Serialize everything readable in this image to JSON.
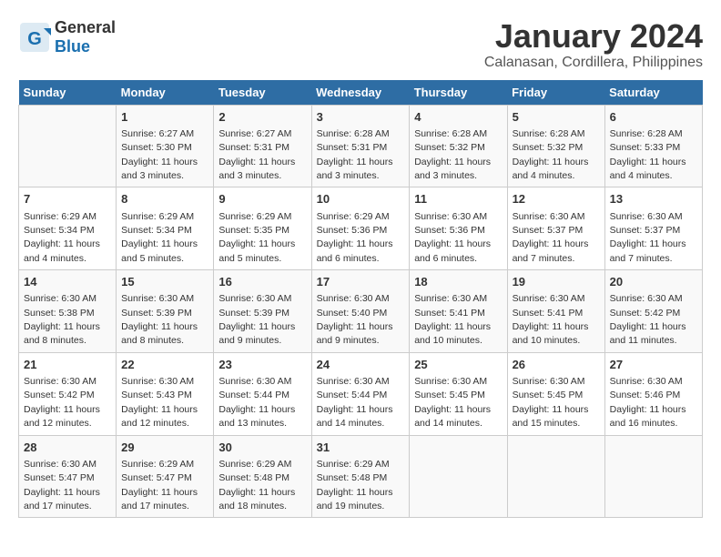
{
  "header": {
    "logo_general": "General",
    "logo_blue": "Blue",
    "month": "January 2024",
    "location": "Calanasan, Cordillera, Philippines"
  },
  "days_of_week": [
    "Sunday",
    "Monday",
    "Tuesday",
    "Wednesday",
    "Thursday",
    "Friday",
    "Saturday"
  ],
  "weeks": [
    [
      {
        "day": "",
        "sunrise": "",
        "sunset": "",
        "daylight": ""
      },
      {
        "day": "1",
        "sunrise": "Sunrise: 6:27 AM",
        "sunset": "Sunset: 5:30 PM",
        "daylight": "Daylight: 11 hours and 3 minutes."
      },
      {
        "day": "2",
        "sunrise": "Sunrise: 6:27 AM",
        "sunset": "Sunset: 5:31 PM",
        "daylight": "Daylight: 11 hours and 3 minutes."
      },
      {
        "day": "3",
        "sunrise": "Sunrise: 6:28 AM",
        "sunset": "Sunset: 5:31 PM",
        "daylight": "Daylight: 11 hours and 3 minutes."
      },
      {
        "day": "4",
        "sunrise": "Sunrise: 6:28 AM",
        "sunset": "Sunset: 5:32 PM",
        "daylight": "Daylight: 11 hours and 3 minutes."
      },
      {
        "day": "5",
        "sunrise": "Sunrise: 6:28 AM",
        "sunset": "Sunset: 5:32 PM",
        "daylight": "Daylight: 11 hours and 4 minutes."
      },
      {
        "day": "6",
        "sunrise": "Sunrise: 6:28 AM",
        "sunset": "Sunset: 5:33 PM",
        "daylight": "Daylight: 11 hours and 4 minutes."
      }
    ],
    [
      {
        "day": "7",
        "sunrise": "Sunrise: 6:29 AM",
        "sunset": "Sunset: 5:34 PM",
        "daylight": "Daylight: 11 hours and 4 minutes."
      },
      {
        "day": "8",
        "sunrise": "Sunrise: 6:29 AM",
        "sunset": "Sunset: 5:34 PM",
        "daylight": "Daylight: 11 hours and 5 minutes."
      },
      {
        "day": "9",
        "sunrise": "Sunrise: 6:29 AM",
        "sunset": "Sunset: 5:35 PM",
        "daylight": "Daylight: 11 hours and 5 minutes."
      },
      {
        "day": "10",
        "sunrise": "Sunrise: 6:29 AM",
        "sunset": "Sunset: 5:36 PM",
        "daylight": "Daylight: 11 hours and 6 minutes."
      },
      {
        "day": "11",
        "sunrise": "Sunrise: 6:30 AM",
        "sunset": "Sunset: 5:36 PM",
        "daylight": "Daylight: 11 hours and 6 minutes."
      },
      {
        "day": "12",
        "sunrise": "Sunrise: 6:30 AM",
        "sunset": "Sunset: 5:37 PM",
        "daylight": "Daylight: 11 hours and 7 minutes."
      },
      {
        "day": "13",
        "sunrise": "Sunrise: 6:30 AM",
        "sunset": "Sunset: 5:37 PM",
        "daylight": "Daylight: 11 hours and 7 minutes."
      }
    ],
    [
      {
        "day": "14",
        "sunrise": "Sunrise: 6:30 AM",
        "sunset": "Sunset: 5:38 PM",
        "daylight": "Daylight: 11 hours and 8 minutes."
      },
      {
        "day": "15",
        "sunrise": "Sunrise: 6:30 AM",
        "sunset": "Sunset: 5:39 PM",
        "daylight": "Daylight: 11 hours and 8 minutes."
      },
      {
        "day": "16",
        "sunrise": "Sunrise: 6:30 AM",
        "sunset": "Sunset: 5:39 PM",
        "daylight": "Daylight: 11 hours and 9 minutes."
      },
      {
        "day": "17",
        "sunrise": "Sunrise: 6:30 AM",
        "sunset": "Sunset: 5:40 PM",
        "daylight": "Daylight: 11 hours and 9 minutes."
      },
      {
        "day": "18",
        "sunrise": "Sunrise: 6:30 AM",
        "sunset": "Sunset: 5:41 PM",
        "daylight": "Daylight: 11 hours and 10 minutes."
      },
      {
        "day": "19",
        "sunrise": "Sunrise: 6:30 AM",
        "sunset": "Sunset: 5:41 PM",
        "daylight": "Daylight: 11 hours and 10 minutes."
      },
      {
        "day": "20",
        "sunrise": "Sunrise: 6:30 AM",
        "sunset": "Sunset: 5:42 PM",
        "daylight": "Daylight: 11 hours and 11 minutes."
      }
    ],
    [
      {
        "day": "21",
        "sunrise": "Sunrise: 6:30 AM",
        "sunset": "Sunset: 5:42 PM",
        "daylight": "Daylight: 11 hours and 12 minutes."
      },
      {
        "day": "22",
        "sunrise": "Sunrise: 6:30 AM",
        "sunset": "Sunset: 5:43 PM",
        "daylight": "Daylight: 11 hours and 12 minutes."
      },
      {
        "day": "23",
        "sunrise": "Sunrise: 6:30 AM",
        "sunset": "Sunset: 5:44 PM",
        "daylight": "Daylight: 11 hours and 13 minutes."
      },
      {
        "day": "24",
        "sunrise": "Sunrise: 6:30 AM",
        "sunset": "Sunset: 5:44 PM",
        "daylight": "Daylight: 11 hours and 14 minutes."
      },
      {
        "day": "25",
        "sunrise": "Sunrise: 6:30 AM",
        "sunset": "Sunset: 5:45 PM",
        "daylight": "Daylight: 11 hours and 14 minutes."
      },
      {
        "day": "26",
        "sunrise": "Sunrise: 6:30 AM",
        "sunset": "Sunset: 5:45 PM",
        "daylight": "Daylight: 11 hours and 15 minutes."
      },
      {
        "day": "27",
        "sunrise": "Sunrise: 6:30 AM",
        "sunset": "Sunset: 5:46 PM",
        "daylight": "Daylight: 11 hours and 16 minutes."
      }
    ],
    [
      {
        "day": "28",
        "sunrise": "Sunrise: 6:30 AM",
        "sunset": "Sunset: 5:47 PM",
        "daylight": "Daylight: 11 hours and 17 minutes."
      },
      {
        "day": "29",
        "sunrise": "Sunrise: 6:29 AM",
        "sunset": "Sunset: 5:47 PM",
        "daylight": "Daylight: 11 hours and 17 minutes."
      },
      {
        "day": "30",
        "sunrise": "Sunrise: 6:29 AM",
        "sunset": "Sunset: 5:48 PM",
        "daylight": "Daylight: 11 hours and 18 minutes."
      },
      {
        "day": "31",
        "sunrise": "Sunrise: 6:29 AM",
        "sunset": "Sunset: 5:48 PM",
        "daylight": "Daylight: 11 hours and 19 minutes."
      },
      {
        "day": "",
        "sunrise": "",
        "sunset": "",
        "daylight": ""
      },
      {
        "day": "",
        "sunrise": "",
        "sunset": "",
        "daylight": ""
      },
      {
        "day": "",
        "sunrise": "",
        "sunset": "",
        "daylight": ""
      }
    ]
  ]
}
